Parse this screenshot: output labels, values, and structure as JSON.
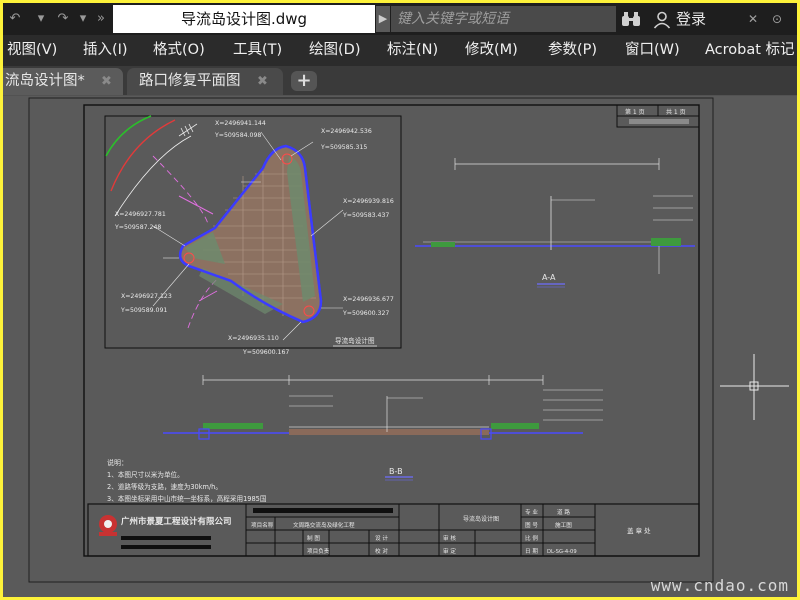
{
  "window": {
    "doc_title": "导流岛设计图.dwg",
    "search_placeholder": "键入关键字或短语",
    "login_label": "登录"
  },
  "menu": {
    "items": [
      "视图(V)",
      "插入(I)",
      "格式(O)",
      "工具(T)",
      "绘图(D)",
      "标注(N)",
      "修改(M)",
      "参数(P)",
      "窗口(W)",
      "Acrobat 标记"
    ]
  },
  "tabs": [
    {
      "label": "流岛设计图*",
      "active": true
    },
    {
      "label": "路口修复平面图",
      "active": false
    }
  ],
  "drawing": {
    "coords": [
      "X=2496941.144",
      "Y=509584.098",
      "X=2496942.536",
      "Y=509585.315",
      "X=2496939.816",
      "Y=509583.437",
      "X=2496927.781",
      "Y=509587.248",
      "X=2496927.123",
      "Y=509589.091",
      "X=2496936.677",
      "Y=509600.327",
      "X=2496935.110",
      "Y=509600.167"
    ],
    "plan_title": "导流岛设计图",
    "section_aa": "A-A",
    "section_bb": "B-B",
    "notes_title": "说明：",
    "notes": [
      "1、本图尺寸以米为单位。",
      "2、道路等级为支路，速度为30km/h。",
      "3、本图坐标采用中山市统一坐标系，高程采用1985国"
    ],
    "company": "广州市景夏工程设计有限公司",
    "title_block": {
      "project_label": "项目名称",
      "project_value": "文周路交流岛及绿化工程",
      "drawing_name": "导流岛设计图",
      "sheet_prefix": "第",
      "sheet_total": "共",
      "field_labels": [
        "专 业",
        "图 号",
        "比 例",
        "日 期",
        "设 计",
        "校 对",
        "审 核",
        "审 定",
        "制 图",
        "项目负责"
      ],
      "field_values": [
        "道 路",
        "施工图",
        "DL-SG-4-09"
      ],
      "stamp": "盖 章 处"
    },
    "page_header": [
      "第 1 页",
      "共 1 页"
    ]
  },
  "watermark": "www.cndao.com"
}
